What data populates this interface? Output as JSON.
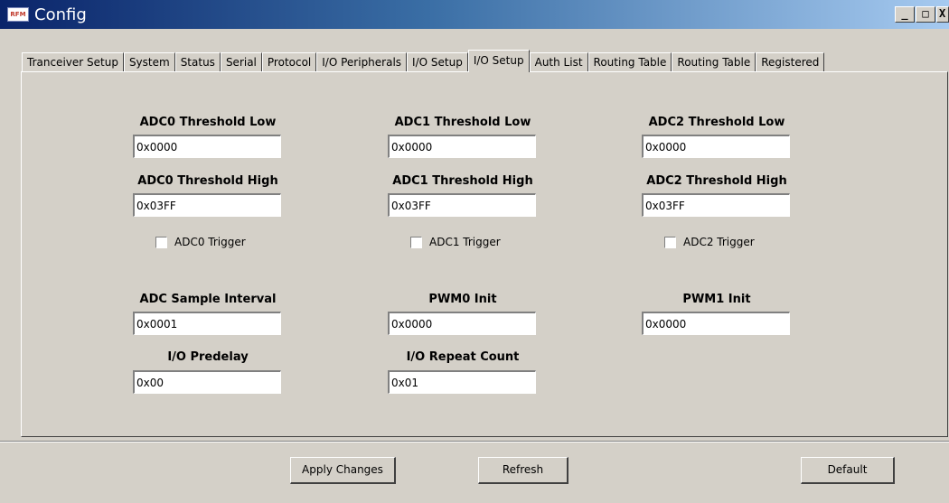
{
  "window": {
    "title": "Config",
    "icon_text": "RFM",
    "minimize": "_",
    "maximize": "□",
    "close": "X"
  },
  "tabs": [
    {
      "label": "Tranceiver Setup",
      "active": false
    },
    {
      "label": "System",
      "active": false
    },
    {
      "label": "Status",
      "active": false
    },
    {
      "label": "Serial",
      "active": false
    },
    {
      "label": "Protocol",
      "active": false
    },
    {
      "label": "I/O Peripherals",
      "active": false
    },
    {
      "label": "I/O Setup",
      "active": false
    },
    {
      "label": "I/O Setup",
      "active": true
    },
    {
      "label": "Auth List",
      "active": false
    },
    {
      "label": "Routing Table",
      "active": false
    },
    {
      "label": "Routing Table",
      "active": false
    },
    {
      "label": "Registered",
      "active": false
    }
  ],
  "fields": {
    "adc0_low": {
      "label": "ADC0 Threshold Low",
      "value": "0x0000"
    },
    "adc1_low": {
      "label": "ADC1 Threshold Low",
      "value": "0x0000"
    },
    "adc2_low": {
      "label": "ADC2 Threshold Low",
      "value": "0x0000"
    },
    "adc0_high": {
      "label": "ADC0 Threshold High",
      "value": "0x03FF"
    },
    "adc1_high": {
      "label": "ADC1 Threshold High",
      "value": "0x03FF"
    },
    "adc2_high": {
      "label": "ADC2 Threshold High",
      "value": "0x03FF"
    },
    "adc_sample": {
      "label": "ADC Sample Interval",
      "value": "0x0001"
    },
    "pwm0": {
      "label": "PWM0 Init",
      "value": "0x0000"
    },
    "pwm1": {
      "label": "PWM1 Init",
      "value": "0x0000"
    },
    "predelay": {
      "label": "I/O Predelay",
      "value": "0x00"
    },
    "repeat": {
      "label": "I/O Repeat Count",
      "value": "0x01"
    }
  },
  "triggers": {
    "adc0": {
      "label": "ADC0 Trigger",
      "checked": false
    },
    "adc1": {
      "label": "ADC1 Trigger",
      "checked": false
    },
    "adc2": {
      "label": "ADC2 Trigger",
      "checked": false
    }
  },
  "buttons": {
    "apply": "Apply Changes",
    "refresh": "Refresh",
    "default": "Default"
  }
}
